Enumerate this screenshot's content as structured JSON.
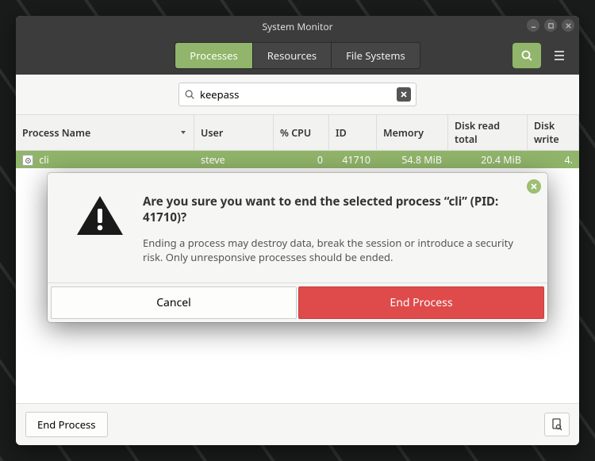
{
  "title": "System Monitor",
  "tabs": {
    "processes": "Processes",
    "resources": "Resources",
    "filesystems": "File Systems",
    "active": 0
  },
  "search": {
    "query": "keepass",
    "icon": "search-icon"
  },
  "columns": {
    "name": "Process Name",
    "user": "User",
    "cpu": "% CPU",
    "id": "ID",
    "memory": "Memory",
    "diskr": "Disk read total",
    "diskw": "Disk write"
  },
  "rows": [
    {
      "name": "cli",
      "user": "steve",
      "cpu": "0",
      "id": "41710",
      "memory": "54.8 MiB",
      "diskr": "20.4 MiB",
      "diskw": "4."
    }
  ],
  "footer": {
    "endprocess": "End Process"
  },
  "dialog": {
    "heading": "Are you sure you want to end the selected process “cli” (PID: 41710)?",
    "body": "Ending a process may destroy data, break the session or introduce a security risk. Only unresponsive processes should be ended.",
    "cancel": "Cancel",
    "end": "End Process"
  }
}
